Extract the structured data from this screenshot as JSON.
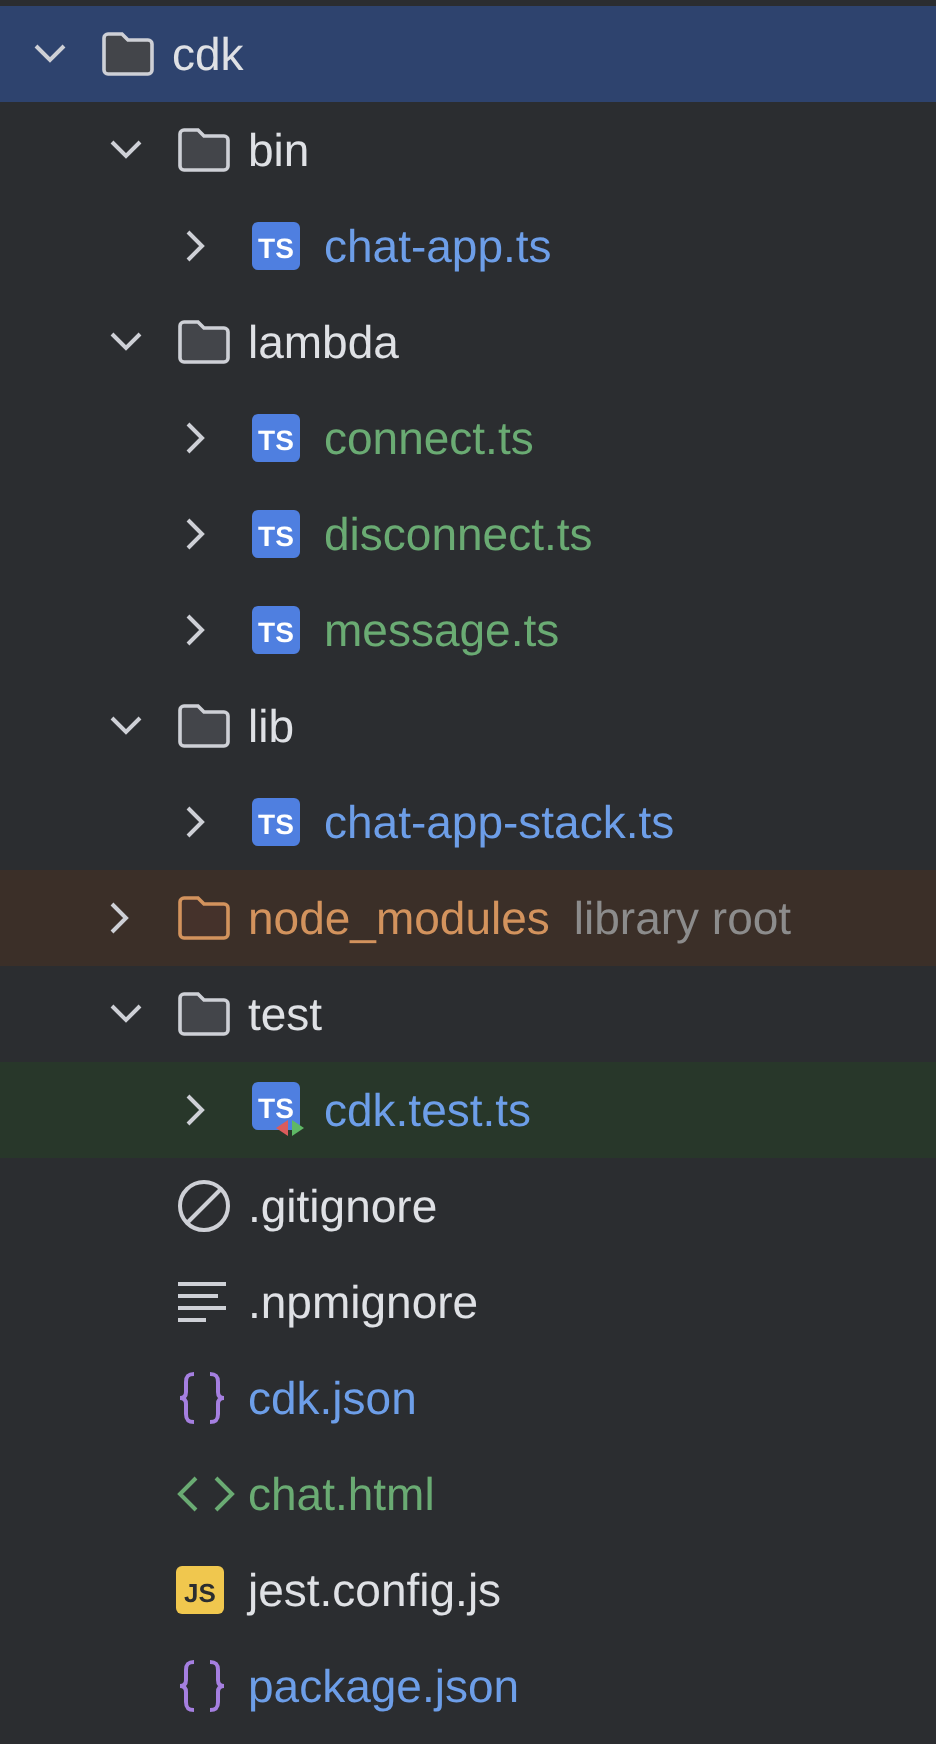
{
  "tree": [
    {
      "name": "cdk",
      "kind": "folder",
      "expanded": true,
      "selected": true,
      "color": "#dfe1e5",
      "children": [
        {
          "name": "bin",
          "kind": "folder",
          "expanded": true,
          "selected": false,
          "color": "#dfe1e5",
          "children": [
            {
              "name": "chat-app.ts",
              "kind": "ts",
              "badge": "TS",
              "expanded": false,
              "selected": false,
              "color": "#6d9ee8"
            }
          ]
        },
        {
          "name": "lambda",
          "kind": "folder",
          "expanded": true,
          "selected": false,
          "color": "#dfe1e5",
          "children": [
            {
              "name": "connect.ts",
              "kind": "ts",
              "badge": "TS",
              "expanded": false,
              "selected": false,
              "color": "#6aab73"
            },
            {
              "name": "disconnect.ts",
              "kind": "ts",
              "badge": "TS",
              "expanded": false,
              "selected": false,
              "color": "#6aab73"
            },
            {
              "name": "message.ts",
              "kind": "ts",
              "badge": "TS",
              "expanded": false,
              "selected": false,
              "color": "#6aab73"
            }
          ]
        },
        {
          "name": "lib",
          "kind": "folder",
          "expanded": true,
          "selected": false,
          "color": "#dfe1e5",
          "children": [
            {
              "name": "chat-app-stack.ts",
              "kind": "ts",
              "badge": "TS",
              "expanded": false,
              "selected": false,
              "color": "#6d9ee8"
            }
          ]
        },
        {
          "name": "node_modules",
          "kind": "library-folder",
          "expanded": false,
          "selected": false,
          "color": "#d3935d",
          "hint": "library root"
        },
        {
          "name": "test",
          "kind": "folder",
          "expanded": true,
          "selected": false,
          "color": "#dfe1e5",
          "children": [
            {
              "name": "cdk.test.ts",
              "kind": "ts-test",
              "badge": "TS",
              "expanded": false,
              "selected": false,
              "color": "#6d9ee8"
            }
          ]
        },
        {
          "name": ".gitignore",
          "kind": "ignore",
          "selected": false,
          "color": "#dfe1e5"
        },
        {
          "name": ".npmignore",
          "kind": "text",
          "selected": false,
          "color": "#dfe1e5"
        },
        {
          "name": "cdk.json",
          "kind": "json",
          "selected": false,
          "color": "#6d9ee8"
        },
        {
          "name": "chat.html",
          "kind": "html",
          "selected": false,
          "color": "#6aab73"
        },
        {
          "name": "jest.config.js",
          "kind": "js",
          "badge": "JS",
          "selected": false,
          "color": "#dfe1e5"
        },
        {
          "name": "package.json",
          "kind": "json",
          "selected": false,
          "color": "#6d9ee8"
        }
      ]
    }
  ]
}
